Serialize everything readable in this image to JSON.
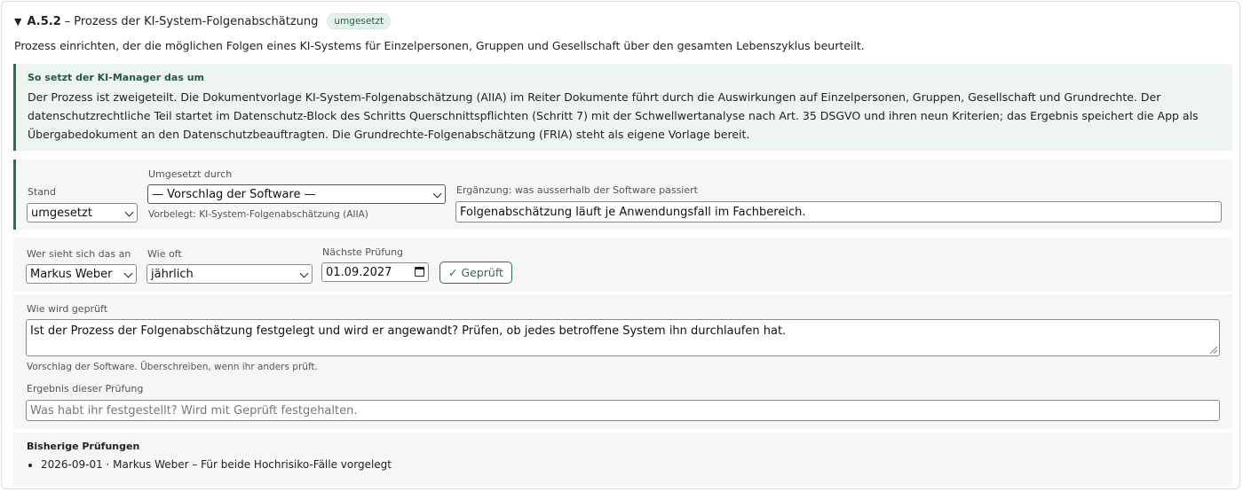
{
  "header": {
    "code": "A.5.2",
    "separator": "–",
    "title": "Prozess der KI-System-Folgenabschätzung",
    "badge": "umgesetzt"
  },
  "description": "Prozess einrichten, der die möglichen Folgen eines KI-Systems für Einzelpersonen, Gruppen und Gesellschaft über den gesamten Lebenszyklus beurteilt.",
  "info": {
    "title": "So setzt der KI-Manager das um",
    "body": "Der Prozess ist zweigeteilt. Die Dokumentvorlage KI-System-Folgenabschätzung (AIIA) im Reiter Dokumente führt durch die Auswirkungen auf Einzelpersonen, Gruppen, Gesellschaft und Grundrechte. Der datenschutzrechtliche Teil startet im Datenschutz-Block des Schritts Querschnittspflichten (Schritt 7) mit der Schwellwertanalyse nach Art. 35 DSGVO und ihren neun Kriterien; das Ergebnis speichert die App als Übergabedokument an den Datenschutzbeauftragten. Die Grundrechte-Folgenabschätzung (FRIA) steht als eigene Vorlage bereit."
  },
  "status": {
    "stand_label": "Stand",
    "stand_value": "umgesetzt",
    "implemented_by_label": "Umgesetzt durch",
    "implemented_by_value": "— Vorschlag der Software —",
    "implemented_by_hint": "Vorbelegt: KI-System-Folgenabschätzung (AIIA)",
    "supplement_label": "Ergänzung: was ausserhalb der Software passiert",
    "supplement_value": "Folgenabschätzung läuft je Anwendungsfall im Fachbereich."
  },
  "review": {
    "reviewer_label": "Wer sieht sich das an",
    "reviewer_value": "Markus Weber",
    "frequency_label": "Wie oft",
    "frequency_value": "jährlich",
    "next_label": "Nächste Prüfung",
    "next_value": "01.09.2027",
    "checked_button": "✓ Geprüft"
  },
  "method": {
    "how_label": "Wie wird geprüft",
    "how_value": "Ist der Prozess der Folgenabschätzung festgelegt und wird er angewandt? Prüfen, ob jedes betroffene System ihn durchlaufen hat.",
    "how_hint": "Vorschlag der Software. Überschreiben, wenn ihr anders prüft.",
    "result_label": "Ergebnis dieser Prüfung",
    "result_placeholder": "Was habt ihr festgestellt? Wird mit Geprüft festgehalten."
  },
  "history": {
    "title": "Bisherige Prüfungen",
    "items": [
      "2026-09-01 · Markus Weber – Für beide Hochrisiko-Fälle vorgelegt"
    ]
  },
  "colors": {
    "accent": "#2e6e50",
    "badge_bg": "#e3f1ea",
    "info_bg": "#eef5f1",
    "panel_bg": "#f6f6f6"
  }
}
